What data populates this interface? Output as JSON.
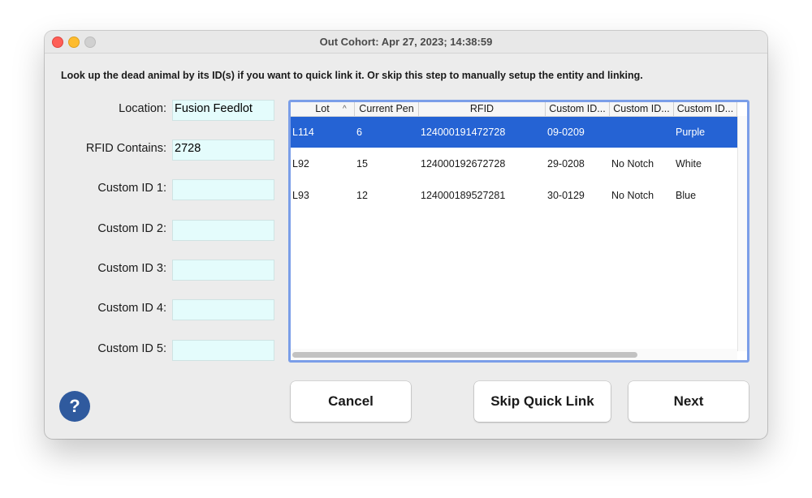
{
  "window": {
    "title": "Out Cohort: Apr 27, 2023; 14:38:59"
  },
  "instructions": "Look up the dead animal by its ID(s) if you want to quick link it. Or skip this step to manually setup the entity and linking.",
  "form": {
    "location": {
      "label": "Location:",
      "value": "Fusion Feedlot"
    },
    "rfid": {
      "label": "RFID Contains:",
      "value": "2728"
    },
    "custom1": {
      "label": "Custom ID 1:",
      "value": ""
    },
    "custom2": {
      "label": "Custom ID 2:",
      "value": ""
    },
    "custom3": {
      "label": "Custom ID 3:",
      "value": ""
    },
    "custom4": {
      "label": "Custom ID 4:",
      "value": ""
    },
    "custom5": {
      "label": "Custom ID 5:",
      "value": ""
    }
  },
  "table": {
    "columns": [
      "Lot",
      "Current Pen",
      "RFID",
      "Custom ID...",
      "Custom ID...",
      "Custom ID..."
    ],
    "sort_indicator": "^",
    "selected_row": 0,
    "rows": [
      [
        "L114",
        "6",
        "124000191472728",
        "09-0209",
        "",
        "Purple"
      ],
      [
        "L92",
        "15",
        "124000192672728",
        "29-0208",
        "No Notch",
        "White"
      ],
      [
        "L93",
        "12",
        "124000189527281",
        "30-0129",
        "No Notch",
        "Blue"
      ]
    ]
  },
  "buttons": {
    "cancel": "Cancel",
    "skip": "Skip Quick Link",
    "next": "Next"
  },
  "help": {
    "icon": "question-icon",
    "glyph": "?"
  },
  "colors": {
    "selection": "#2563d4",
    "input_bg": "#e4fcfc",
    "table_border": "#7b9ee8",
    "help_bg": "#2f5a9e"
  }
}
